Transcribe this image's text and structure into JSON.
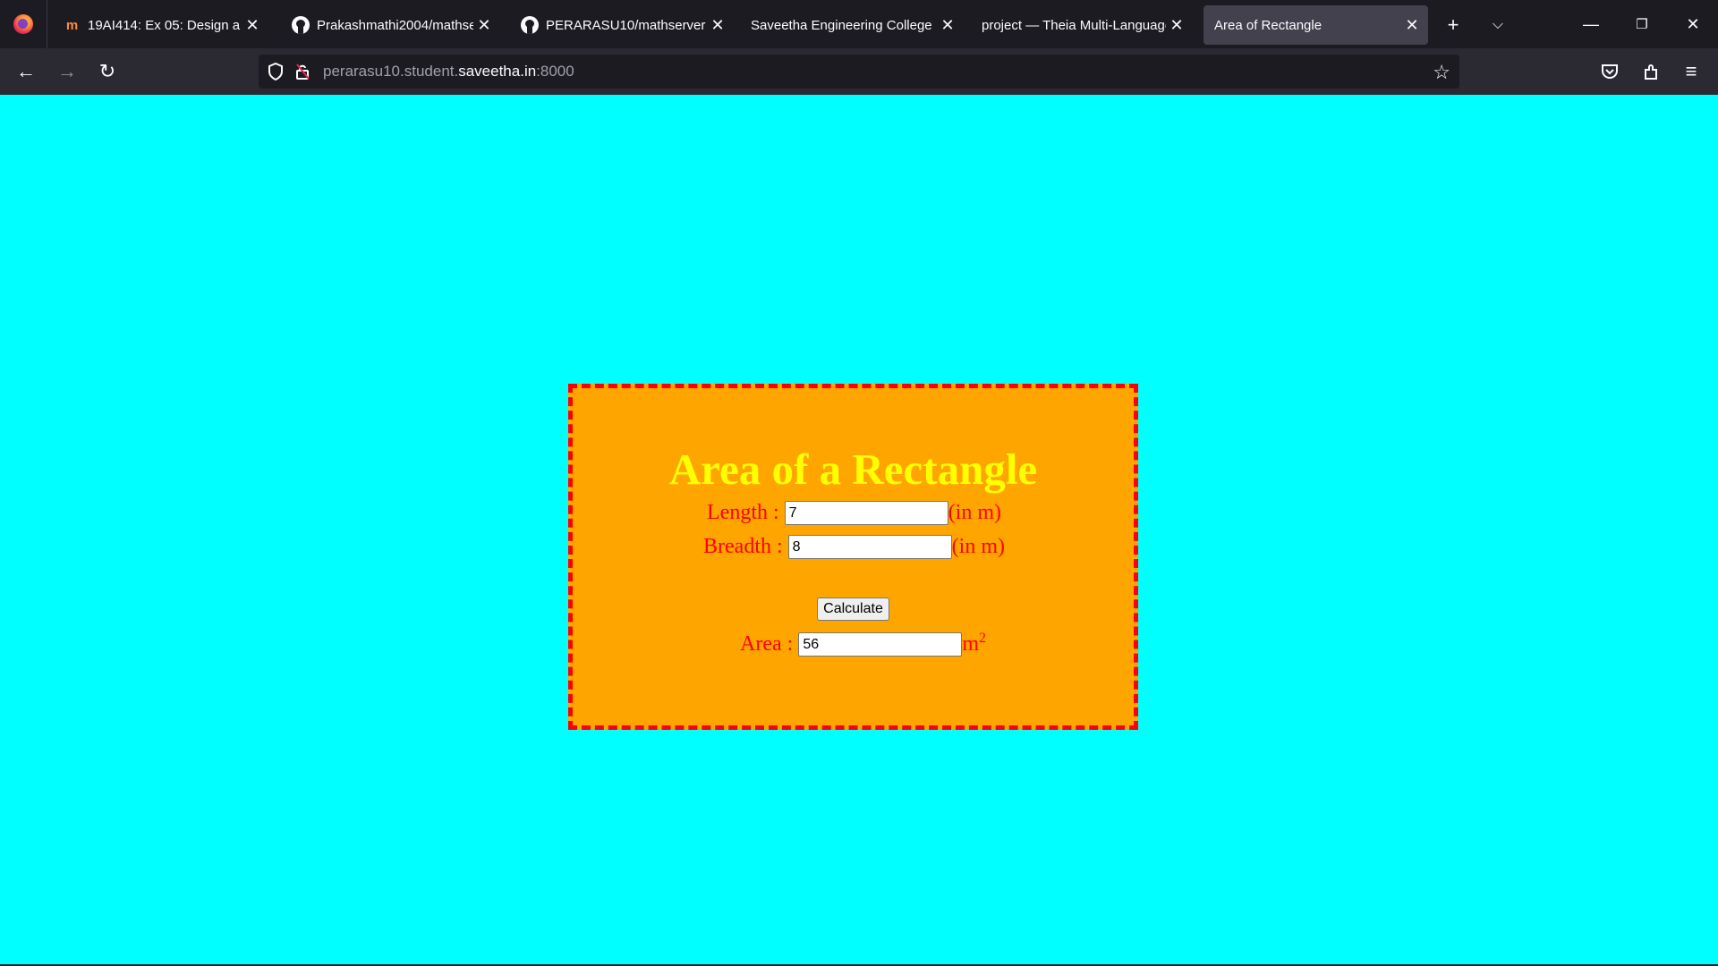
{
  "browser": {
    "tabs": [
      {
        "title": "19AI414: Ex 05: Design a We",
        "favicon": "moodle-icon",
        "active": false
      },
      {
        "title": "Prakashmathi2004/mathserv",
        "favicon": "github-icon",
        "active": false
      },
      {
        "title": "PERARASU10/mathserver",
        "favicon": "github-icon",
        "active": false
      },
      {
        "title": "Saveetha Engineering College",
        "favicon": "",
        "active": false
      },
      {
        "title": "project — Theia Multi-Language",
        "favicon": "",
        "active": false
      },
      {
        "title": "Area of Rectangle",
        "favicon": "",
        "active": true
      }
    ],
    "url": {
      "prefix": "perarasu10.student.",
      "host": "saveetha.in",
      "suffix": ":8000"
    }
  },
  "page": {
    "heading": "Area of a Rectangle",
    "length": {
      "label": "Length :",
      "value": "7",
      "unit": "(in m)"
    },
    "breadth": {
      "label": "Breadth :",
      "value": "8",
      "unit": "(in m)"
    },
    "calculate_label": "Calculate",
    "area": {
      "label": "Area :",
      "value": "56",
      "unit": "m",
      "unit_power": "2"
    }
  },
  "colors": {
    "page_background": "#00ffff",
    "box_background": "#ffa500",
    "box_border": "#ff0000",
    "heading": "#ffff00",
    "label_text": "#ff0000"
  }
}
